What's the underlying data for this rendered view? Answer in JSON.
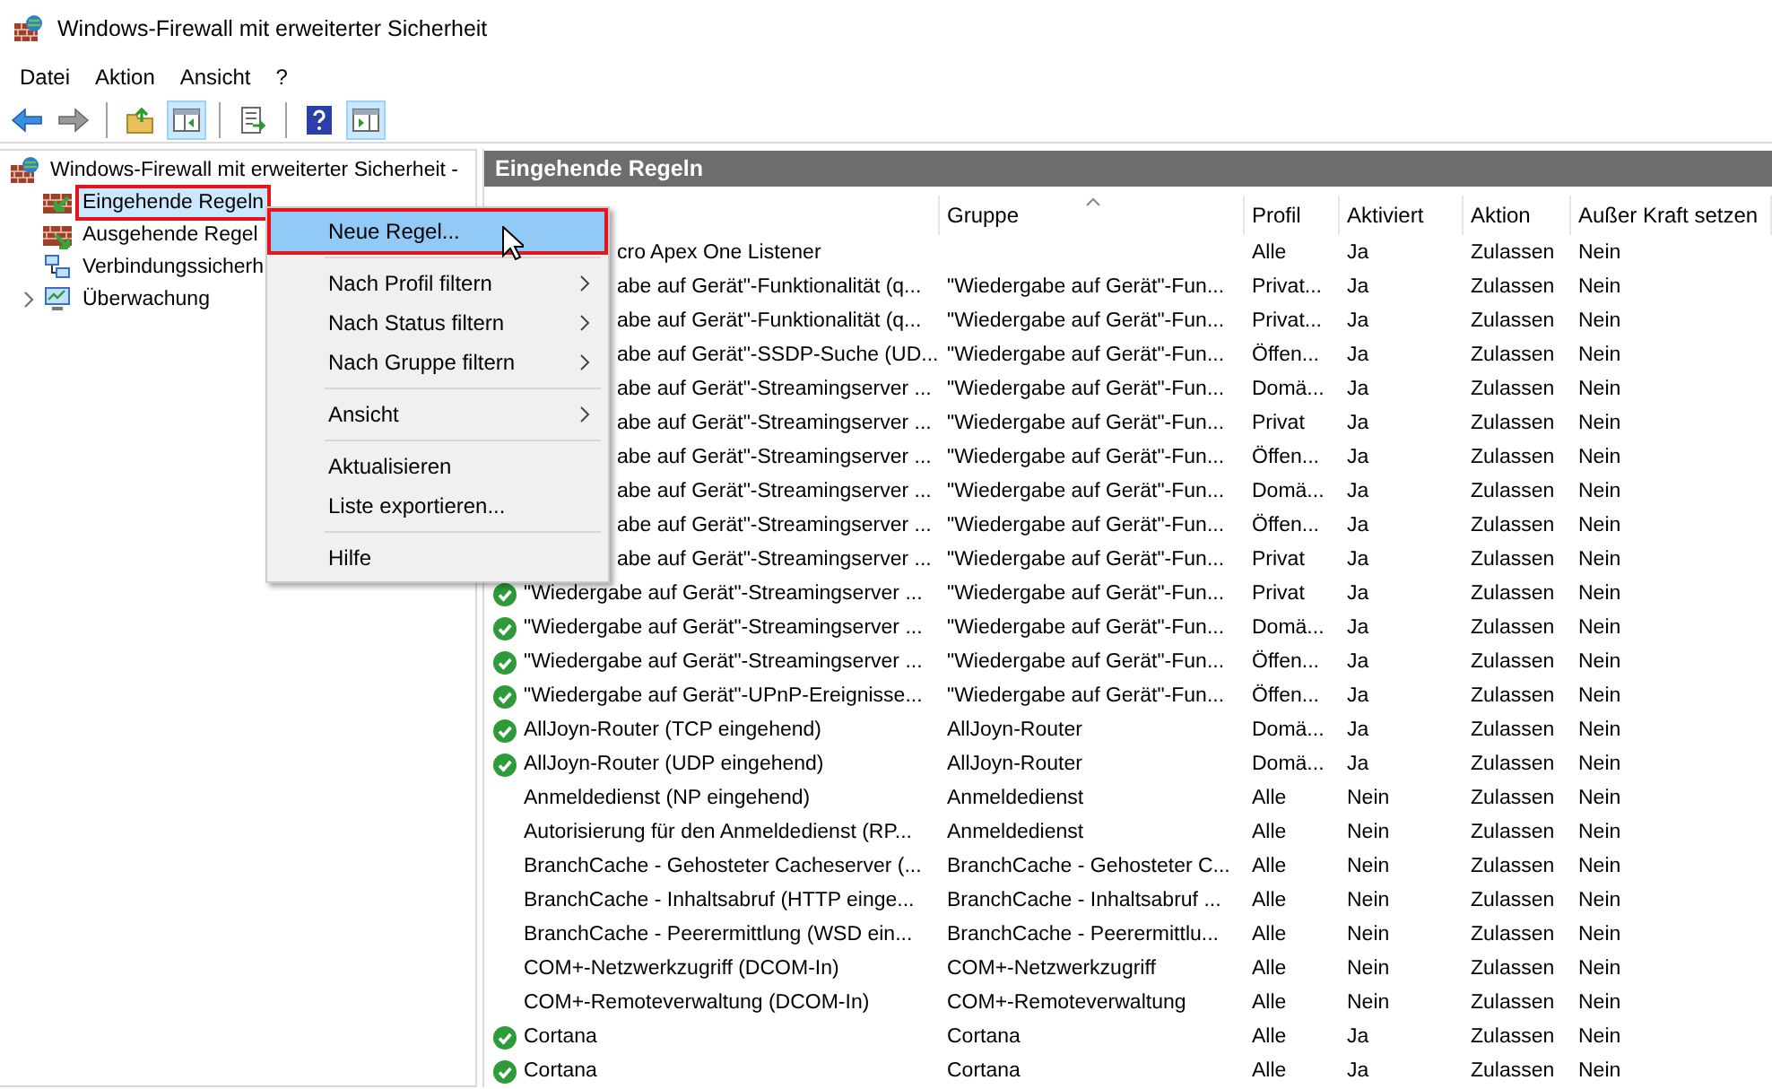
{
  "window": {
    "title": "Windows-Firewall mit erweiterter Sicherheit"
  },
  "menu_bar": [
    "Datei",
    "Aktion",
    "Ansicht",
    "?"
  ],
  "toolbar": [
    {
      "kind": "back",
      "pressed": false
    },
    {
      "kind": "forward",
      "pressed": false,
      "disabled": true
    },
    {
      "kind": "separator"
    },
    {
      "kind": "up",
      "pressed": false
    },
    {
      "kind": "tree",
      "pressed": true
    },
    {
      "kind": "separator"
    },
    {
      "kind": "export",
      "pressed": false
    },
    {
      "kind": "separator"
    },
    {
      "kind": "help",
      "pressed": false
    },
    {
      "kind": "actions",
      "pressed": true
    }
  ],
  "tree": {
    "label": "Windows-Firewall mit erweiterter Sicherheit -",
    "children": [
      {
        "label": "Eingehende Regeln",
        "selected": true,
        "marked": true
      },
      {
        "label": "Ausgehende Regel",
        "selected": false,
        "marked": false
      },
      {
        "label": "Verbindungssicherh",
        "selected": false,
        "marked": false
      },
      {
        "label": "Überwachung",
        "selected": false,
        "marked": false,
        "expanded": false
      }
    ]
  },
  "panel": {
    "title": "Eingehende Regeln",
    "columns": [
      {
        "label": "Gruppe",
        "sorted": true
      },
      {
        "label": "Profil",
        "sorted": false
      },
      {
        "label": "Aktiviert",
        "sorted": false
      },
      {
        "label": "Aktion",
        "sorted": false
      },
      {
        "label": "Außer Kraft setzen",
        "sorted": false
      }
    ],
    "rows": [
      {
        "kind": "covered",
        "name": "cro Apex One Listener",
        "profile": "Alle",
        "enabled": "Ja",
        "action": "Zulassen",
        "override": "Nein"
      },
      {
        "kind": "covered",
        "name": "abe auf Gerät\"-Funktionalität (q...",
        "group": "\"Wiedergabe auf Gerät\"-Fun...",
        "profile": "Privat...",
        "enabled": "Ja",
        "action": "Zulassen",
        "override": "Nein"
      },
      {
        "kind": "covered",
        "name": "abe auf Gerät\"-Funktionalität (q...",
        "group": "\"Wiedergabe auf Gerät\"-Fun...",
        "profile": "Privat...",
        "enabled": "Ja",
        "action": "Zulassen",
        "override": "Nein"
      },
      {
        "kind": "covered",
        "name": "abe auf Gerät\"-SSDP-Suche (UD...",
        "group": "\"Wiedergabe auf Gerät\"-Fun...",
        "profile": "Öffen...",
        "enabled": "Ja",
        "action": "Zulassen",
        "override": "Nein"
      },
      {
        "kind": "covered",
        "name": "abe auf Gerät\"-Streamingserver ...",
        "group": "\"Wiedergabe auf Gerät\"-Fun...",
        "profile": "Domä...",
        "enabled": "Ja",
        "action": "Zulassen",
        "override": "Nein"
      },
      {
        "kind": "covered",
        "name": "abe auf Gerät\"-Streamingserver ...",
        "group": "\"Wiedergabe auf Gerät\"-Fun...",
        "profile": "Privat",
        "enabled": "Ja",
        "action": "Zulassen",
        "override": "Nein"
      },
      {
        "kind": "covered",
        "name": "abe auf Gerät\"-Streamingserver ...",
        "group": "\"Wiedergabe auf Gerät\"-Fun...",
        "profile": "Öffen...",
        "enabled": "Ja",
        "action": "Zulassen",
        "override": "Nein"
      },
      {
        "kind": "covered",
        "name": "abe auf Gerät\"-Streamingserver ...",
        "group": "\"Wiedergabe auf Gerät\"-Fun...",
        "profile": "Domä...",
        "enabled": "Ja",
        "action": "Zulassen",
        "override": "Nein"
      },
      {
        "kind": "covered",
        "name": "abe auf Gerät\"-Streamingserver ...",
        "group": "\"Wiedergabe auf Gerät\"-Fun...",
        "profile": "Öffen...",
        "enabled": "Ja",
        "action": "Zulassen",
        "override": "Nein"
      },
      {
        "kind": "covered",
        "name": "abe auf Gerät\"-Streamingserver ...",
        "group": "\"Wiedergabe auf Gerät\"-Fun...",
        "profile": "Privat",
        "enabled": "Ja",
        "action": "Zulassen",
        "override": "Nein"
      },
      {
        "kind": "full",
        "active": true,
        "name": "\"Wiedergabe auf Gerät\"-Streamingserver ...",
        "group": "\"Wiedergabe auf Gerät\"-Fun...",
        "profile": "Privat",
        "enabled": "Ja",
        "action": "Zulassen",
        "override": "Nein"
      },
      {
        "kind": "full",
        "active": true,
        "name": "\"Wiedergabe auf Gerät\"-Streamingserver ...",
        "group": "\"Wiedergabe auf Gerät\"-Fun...",
        "profile": "Domä...",
        "enabled": "Ja",
        "action": "Zulassen",
        "override": "Nein"
      },
      {
        "kind": "full",
        "active": true,
        "name": "\"Wiedergabe auf Gerät\"-Streamingserver ...",
        "group": "\"Wiedergabe auf Gerät\"-Fun...",
        "profile": "Öffen...",
        "enabled": "Ja",
        "action": "Zulassen",
        "override": "Nein"
      },
      {
        "kind": "full",
        "active": true,
        "name": "\"Wiedergabe auf Gerät\"-UPnP-Ereignisse...",
        "group": "\"Wiedergabe auf Gerät\"-Fun...",
        "profile": "Öffen...",
        "enabled": "Ja",
        "action": "Zulassen",
        "override": "Nein"
      },
      {
        "kind": "full",
        "active": true,
        "name": "AllJoyn-Router (TCP eingehend)",
        "group": "AllJoyn-Router",
        "profile": "Domä...",
        "enabled": "Ja",
        "action": "Zulassen",
        "override": "Nein"
      },
      {
        "kind": "full",
        "active": true,
        "name": "AllJoyn-Router (UDP eingehend)",
        "group": "AllJoyn-Router",
        "profile": "Domä...",
        "enabled": "Ja",
        "action": "Zulassen",
        "override": "Nein"
      },
      {
        "kind": "full",
        "active": false,
        "name": "Anmeldedienst (NP eingehend)",
        "group": "Anmeldedienst",
        "profile": "Alle",
        "enabled": "Nein",
        "action": "Zulassen",
        "override": "Nein"
      },
      {
        "kind": "full",
        "active": false,
        "name": "Autorisierung für den Anmeldedienst (RP...",
        "group": "Anmeldedienst",
        "profile": "Alle",
        "enabled": "Nein",
        "action": "Zulassen",
        "override": "Nein"
      },
      {
        "kind": "full",
        "active": false,
        "name": "BranchCache - Gehosteter Cacheserver (...",
        "group": "BranchCache - Gehosteter C...",
        "profile": "Alle",
        "enabled": "Nein",
        "action": "Zulassen",
        "override": "Nein"
      },
      {
        "kind": "full",
        "active": false,
        "name": "BranchCache - Inhaltsabruf (HTTP einge...",
        "group": "BranchCache - Inhaltsabruf ...",
        "profile": "Alle",
        "enabled": "Nein",
        "action": "Zulassen",
        "override": "Nein"
      },
      {
        "kind": "full",
        "active": false,
        "name": "BranchCache - Peerermittlung (WSD ein...",
        "group": "BranchCache - Peerermittlu...",
        "profile": "Alle",
        "enabled": "Nein",
        "action": "Zulassen",
        "override": "Nein"
      },
      {
        "kind": "full",
        "active": false,
        "name": "COM+-Netzwerkzugriff (DCOM-In)",
        "group": "COM+-Netzwerkzugriff",
        "profile": "Alle",
        "enabled": "Nein",
        "action": "Zulassen",
        "override": "Nein"
      },
      {
        "kind": "full",
        "active": false,
        "name": "COM+-Remoteverwaltung (DCOM-In)",
        "group": "COM+-Remoteverwaltung",
        "profile": "Alle",
        "enabled": "Nein",
        "action": "Zulassen",
        "override": "Nein"
      },
      {
        "kind": "full",
        "active": true,
        "name": "Cortana",
        "group": "Cortana",
        "profile": "Alle",
        "enabled": "Ja",
        "action": "Zulassen",
        "override": "Nein"
      },
      {
        "kind": "full",
        "active": true,
        "name": "Cortana",
        "group": "Cortana",
        "profile": "Alle",
        "enabled": "Ja",
        "action": "Zulassen",
        "override": "Nein"
      }
    ]
  },
  "context_menu": [
    {
      "kind": "item",
      "label": "Neue Regel...",
      "selected": true,
      "marked": true,
      "submenu": false
    },
    {
      "kind": "separator"
    },
    {
      "kind": "item",
      "label": "Nach Profil filtern",
      "selected": false,
      "marked": false,
      "submenu": true
    },
    {
      "kind": "item",
      "label": "Nach Status filtern",
      "selected": false,
      "marked": false,
      "submenu": true
    },
    {
      "kind": "item",
      "label": "Nach Gruppe filtern",
      "selected": false,
      "marked": false,
      "submenu": true
    },
    {
      "kind": "separator"
    },
    {
      "kind": "item",
      "label": "Ansicht",
      "selected": false,
      "marked": false,
      "submenu": true
    },
    {
      "kind": "separator"
    },
    {
      "kind": "item",
      "label": "Aktualisieren",
      "selected": false,
      "marked": false,
      "submenu": false
    },
    {
      "kind": "item",
      "label": "Liste exportieren...",
      "selected": false,
      "marked": false,
      "submenu": false
    },
    {
      "kind": "separator"
    },
    {
      "kind": "item",
      "label": "Hilfe",
      "selected": false,
      "marked": false,
      "submenu": false
    }
  ]
}
